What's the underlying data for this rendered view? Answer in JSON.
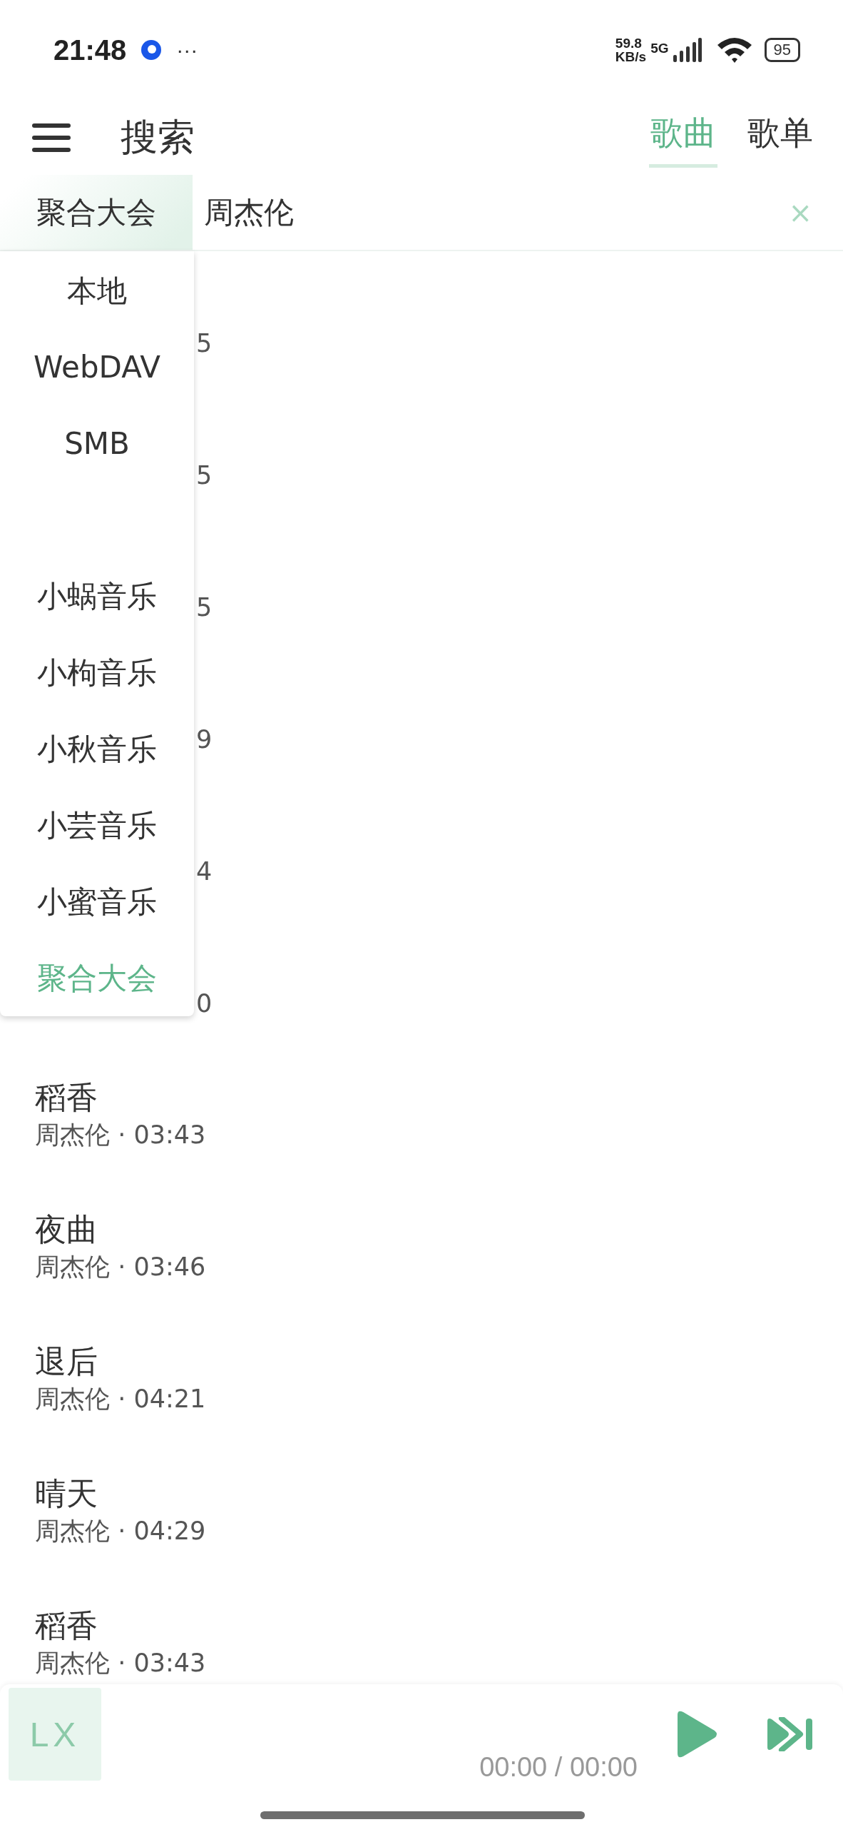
{
  "status_bar": {
    "time": "21:48",
    "more": "···",
    "speed_value": "59.8",
    "speed_unit": "KB/s",
    "network": "5G",
    "battery": "95"
  },
  "header": {
    "title": "搜索",
    "tabs": [
      {
        "label": "歌曲",
        "selected": true
      },
      {
        "label": "歌单",
        "selected": false
      }
    ]
  },
  "search": {
    "source": "聚合大会",
    "value": "周杰伦",
    "clear": "×"
  },
  "source_menu": {
    "items": [
      {
        "kind": "source",
        "label": "本地",
        "selected": false
      },
      {
        "kind": "source",
        "label": "WebDAV",
        "selected": false
      },
      {
        "kind": "source",
        "label": "SMB",
        "selected": false
      },
      {
        "kind": "blank"
      },
      {
        "kind": "source",
        "label": "小蜗音乐",
        "selected": false
      },
      {
        "kind": "source",
        "label": "小枸音乐",
        "selected": false
      },
      {
        "kind": "source",
        "label": "小秋音乐",
        "selected": false
      },
      {
        "kind": "source",
        "label": "小芸音乐",
        "selected": false
      },
      {
        "kind": "source",
        "label": "小蜜音乐",
        "selected": false
      },
      {
        "kind": "source",
        "label": "聚合大会",
        "selected": true
      }
    ]
  },
  "songs": [
    {
      "kind": "covered",
      "fragment": "5"
    },
    {
      "kind": "covered",
      "fragment": "5"
    },
    {
      "kind": "covered",
      "fragment": "5"
    },
    {
      "kind": "covered",
      "fragment": "9"
    },
    {
      "kind": "covered",
      "fragment": "4"
    },
    {
      "kind": "covered",
      "fragment": "0"
    },
    {
      "kind": "song",
      "name": "稻香",
      "meta": "周杰伦 · 03:43"
    },
    {
      "kind": "song",
      "name": "夜曲",
      "meta": "周杰伦 · 03:46"
    },
    {
      "kind": "song",
      "name": "退后",
      "meta": "周杰伦 · 04:21"
    },
    {
      "kind": "song",
      "name": "晴天",
      "meta": "周杰伦 · 04:29"
    },
    {
      "kind": "song",
      "name": "稻香",
      "meta": "周杰伦 · 03:43"
    }
  ],
  "player": {
    "cover": "LX",
    "time": "00:00 / 00:00"
  }
}
